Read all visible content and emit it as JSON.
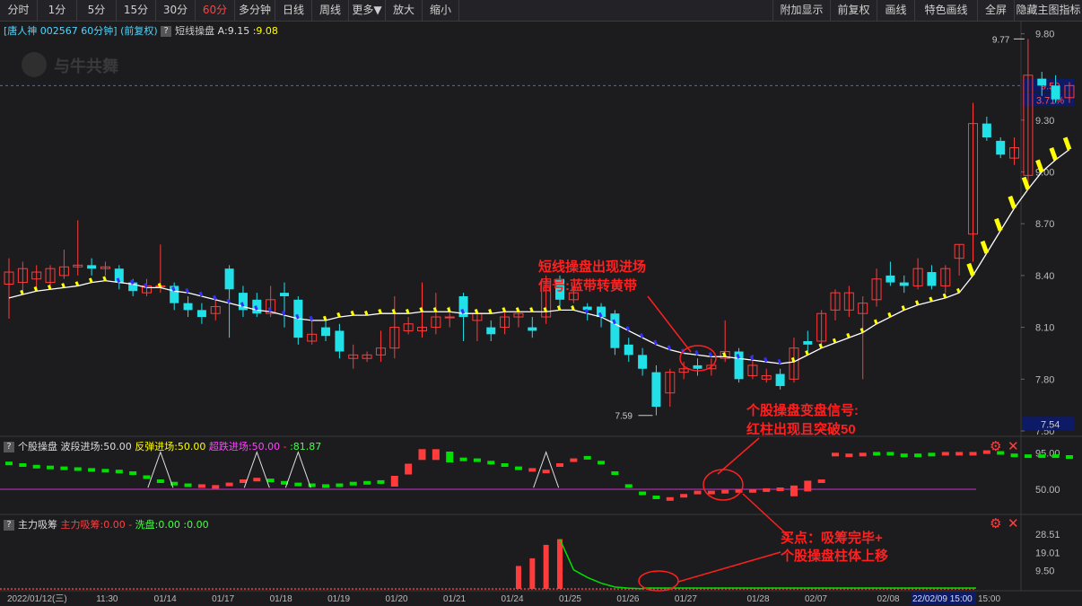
{
  "toolbar": {
    "left": [
      "分时",
      "1分",
      "5分",
      "15分",
      "30分",
      "60分",
      "多分钟",
      "日线",
      "周线",
      "更多▼",
      "放大",
      "缩小"
    ],
    "active": "60分",
    "right": [
      "附加显示",
      "前复权",
      "画线",
      "特色画线",
      "全屏",
      "隐藏主图指标"
    ]
  },
  "main_header": {
    "stock": "[唐人神 002567 60分钟]",
    "mode": "(前复权)",
    "indicator": "短线操盘",
    "a_label": "A:9.15",
    "b_label": ":9.08"
  },
  "watermark": "与牛共舞",
  "price_panel": {
    "yticks": [
      "9.80",
      "9.30",
      "9.00",
      "8.70",
      "8.40",
      "8.10",
      "7.80",
      "7.50"
    ],
    "last_price": "9.50",
    "change_pct": "3.71%",
    "low_box": "7.54",
    "high_label": "9.77",
    "low_label": "7.59"
  },
  "mid_panel": {
    "title": "个股操盘",
    "fields": [
      "波段进场:50.00",
      "反弹进场:50.00",
      "超跌进场:50.00"
    ],
    "extra": ":81.87",
    "yticks": [
      "95.00",
      "50.00"
    ]
  },
  "bottom_panel": {
    "title": "主力吸筹",
    "fields": [
      "主力吸筹:0.00",
      "洗盘:0.00",
      ":0.00"
    ],
    "yticks": [
      "28.51",
      "19.01",
      "9.50"
    ]
  },
  "x_axis": {
    "labels": [
      "2022/01/12(三)",
      "11:30",
      "01/14",
      "01/17",
      "01/18",
      "01/19",
      "01/20",
      "01/21",
      "01/24",
      "01/25",
      "01/26",
      "01/27",
      "01/28",
      "02/07",
      "02/08",
      "02/09"
    ],
    "highlight": "22/02/09 15:00",
    "tail": "15:00"
  },
  "annotations": {
    "a1": [
      "短线操盘出现进场",
      "信号:蓝带转黄带"
    ],
    "a2": [
      "个股操盘变盘信号:",
      "红柱出现且突破50"
    ],
    "a3": [
      "买点：吸筹完毕+",
      "个股操盘柱体上移"
    ]
  },
  "colors": {
    "up": "#ff3b3b",
    "down": "#22e0e8",
    "line": "#ffffff",
    "yellow": "#ffff00",
    "blue": "#3030ff",
    "green": "#00e000",
    "magenta": "#cc33cc",
    "annot": "#ff2020"
  },
  "chart_data": [
    {
      "type": "candlestick",
      "title": "短线操盘",
      "ylim": [
        7.5,
        9.85
      ],
      "candles": [
        [
          8.35,
          8.42,
          8.5,
          8.15
        ],
        [
          8.36,
          8.44,
          8.48,
          8.3
        ],
        [
          8.38,
          8.42,
          8.46,
          8.32
        ],
        [
          8.36,
          8.44,
          8.46,
          8.32
        ],
        [
          8.4,
          8.45,
          8.55,
          8.38
        ],
        [
          8.45,
          8.46,
          8.72,
          8.4
        ],
        [
          8.46,
          8.44,
          8.5,
          8.4
        ],
        [
          8.44,
          8.45,
          8.48,
          8.4
        ],
        [
          8.44,
          8.36,
          8.46,
          8.32
        ],
        [
          8.36,
          8.31,
          8.38,
          8.28
        ],
        [
          8.3,
          8.34,
          8.38,
          8.28
        ],
        [
          8.34,
          8.34,
          8.58,
          8.3
        ],
        [
          8.34,
          8.24,
          8.36,
          8.2
        ],
        [
          8.24,
          8.2,
          8.28,
          8.16
        ],
        [
          8.2,
          8.16,
          8.24,
          8.12
        ],
        [
          8.18,
          8.22,
          8.26,
          8.14
        ],
        [
          8.44,
          8.32,
          8.46,
          8.04
        ],
        [
          8.3,
          8.2,
          8.34,
          8.16
        ],
        [
          8.26,
          8.18,
          8.3,
          8.16
        ],
        [
          8.18,
          8.26,
          8.34,
          8.16
        ],
        [
          8.3,
          8.28,
          8.36,
          8.1
        ],
        [
          8.26,
          8.04,
          8.28,
          8.0
        ],
        [
          8.02,
          8.06,
          8.16,
          8.0
        ],
        [
          8.1,
          8.05,
          8.16,
          8.02
        ],
        [
          8.08,
          7.96,
          8.12,
          7.92
        ],
        [
          7.92,
          7.94,
          8.0,
          7.86
        ],
        [
          7.92,
          7.94,
          7.96,
          7.9
        ],
        [
          7.94,
          7.98,
          8.08,
          7.9
        ],
        [
          7.98,
          8.1,
          8.28,
          7.92
        ],
        [
          8.08,
          8.12,
          8.16,
          8.06
        ],
        [
          8.08,
          8.1,
          8.36,
          8.04
        ],
        [
          8.1,
          8.16,
          8.3,
          8.06
        ],
        [
          8.16,
          8.16,
          8.22,
          8.1
        ],
        [
          8.28,
          8.16,
          8.3,
          8.02
        ],
        [
          8.14,
          8.18,
          8.2,
          8.02
        ],
        [
          8.1,
          8.06,
          8.14,
          8.02
        ],
        [
          8.1,
          8.16,
          8.2,
          8.06
        ],
        [
          8.16,
          8.18,
          8.2,
          8.1
        ],
        [
          8.1,
          8.08,
          8.16,
          8.04
        ],
        [
          8.16,
          8.38,
          8.4,
          8.12
        ],
        [
          8.38,
          8.26,
          8.4,
          8.22
        ],
        [
          8.26,
          8.3,
          8.34,
          8.24
        ],
        [
          8.22,
          8.2,
          8.24,
          8.14
        ],
        [
          8.22,
          8.16,
          8.24,
          8.1
        ],
        [
          8.18,
          7.98,
          8.2,
          7.94
        ],
        [
          8.0,
          7.94,
          8.04,
          7.9
        ],
        [
          7.94,
          7.86,
          7.98,
          7.82
        ],
        [
          7.84,
          7.64,
          7.88,
          7.59
        ],
        [
          7.72,
          7.84,
          7.86,
          7.64
        ],
        [
          7.84,
          7.86,
          7.9,
          7.8
        ],
        [
          7.88,
          7.86,
          7.92,
          7.82
        ],
        [
          7.86,
          7.88,
          7.92,
          7.82
        ],
        [
          7.92,
          7.96,
          8.14,
          7.9
        ],
        [
          7.96,
          7.8,
          7.98,
          7.78
        ],
        [
          7.82,
          7.88,
          7.94,
          7.8
        ],
        [
          7.8,
          7.82,
          7.86,
          7.78
        ],
        [
          7.83,
          7.76,
          7.86,
          7.74
        ],
        [
          7.8,
          7.98,
          8.04,
          7.78
        ],
        [
          8.02,
          8.0,
          8.08,
          7.96
        ],
        [
          8.02,
          8.18,
          8.2,
          7.98
        ],
        [
          8.2,
          8.3,
          8.32,
          8.14
        ],
        [
          8.2,
          8.3,
          8.34,
          8.16
        ],
        [
          8.18,
          8.24,
          8.28,
          7.8
        ],
        [
          8.26,
          8.38,
          8.44,
          8.22
        ],
        [
          8.4,
          8.36,
          8.48,
          8.34
        ],
        [
          8.36,
          8.34,
          8.4,
          8.3
        ],
        [
          8.34,
          8.44,
          8.5,
          8.32
        ],
        [
          8.42,
          8.34,
          8.46,
          8.32
        ],
        [
          8.34,
          8.44,
          8.46,
          8.3
        ],
        [
          8.5,
          8.58,
          8.58,
          8.4
        ],
        [
          8.64,
          9.28,
          9.4,
          8.48
        ],
        [
          9.28,
          9.2,
          9.32,
          9.18
        ],
        [
          9.18,
          9.1,
          9.2,
          9.08
        ],
        [
          9.08,
          9.14,
          9.2,
          9.04
        ],
        [
          8.98,
          9.56,
          9.77,
          8.92
        ],
        [
          9.54,
          9.5,
          9.58,
          9.44
        ],
        [
          9.5,
          9.42,
          9.56,
          9.4
        ],
        [
          9.43,
          9.5,
          9.52,
          9.4
        ]
      ],
      "ma": [
        8.27,
        8.29,
        8.31,
        8.32,
        8.33,
        8.34,
        8.36,
        8.37,
        8.36,
        8.35,
        8.33,
        8.33,
        8.31,
        8.3,
        8.28,
        8.26,
        8.24,
        8.22,
        8.2,
        8.19,
        8.17,
        8.15,
        8.14,
        8.14,
        8.16,
        8.17,
        8.17,
        8.18,
        8.18,
        8.18,
        8.19,
        8.19,
        8.19,
        8.18,
        8.18,
        8.18,
        8.19,
        8.19,
        8.19,
        8.19,
        8.2,
        8.2,
        8.18,
        8.16,
        8.12,
        8.08,
        8.04,
        8.0,
        7.97,
        7.95,
        7.94,
        7.93,
        7.93,
        7.92,
        7.91,
        7.9,
        7.89,
        7.9,
        7.94,
        7.98,
        8.01,
        8.04,
        8.07,
        8.12,
        8.16,
        8.2,
        8.23,
        8.25,
        8.27,
        8.3,
        8.4,
        8.53,
        8.66,
        8.79,
        8.9,
        9.0,
        9.07,
        9.13
      ],
      "ma_color_switch_index": 57
    },
    {
      "type": "bar-segments",
      "title": "个股操盘",
      "ylim": [
        20,
        100
      ],
      "values": [
        82,
        80,
        78,
        77,
        76,
        75,
        74,
        73,
        72,
        70,
        65,
        60,
        57,
        55,
        54,
        53,
        56,
        60,
        62,
        61,
        58,
        56,
        55,
        54,
        55,
        57,
        58,
        59,
        60,
        75,
        93,
        93,
        90,
        87,
        86,
        83,
        80,
        76,
        74,
        72,
        80,
        86,
        89,
        83,
        70,
        54,
        45,
        40,
        38,
        42,
        46,
        46,
        47,
        48,
        48,
        49,
        50,
        48,
        54,
        60,
        93,
        92,
        93,
        94,
        94,
        92,
        92,
        93,
        94,
        94,
        94,
        96,
        95,
        92,
        91,
        91,
        91,
        90
      ],
      "up_flags": [
        false,
        false,
        false,
        false,
        false,
        false,
        false,
        false,
        false,
        false,
        false,
        false,
        false,
        false,
        true,
        true,
        true,
        true,
        true,
        false,
        false,
        false,
        false,
        false,
        false,
        false,
        false,
        false,
        true,
        true,
        true,
        true,
        false,
        false,
        false,
        false,
        false,
        false,
        true,
        true,
        true,
        true,
        false,
        false,
        false,
        false,
        false,
        false,
        true,
        true,
        true,
        true,
        true,
        true,
        true,
        true,
        true,
        true,
        true,
        true,
        true,
        true,
        true,
        false,
        false,
        false,
        false,
        false,
        true,
        true,
        true,
        true,
        false,
        false,
        false,
        false,
        false,
        false
      ],
      "triangles_at": [
        11,
        18,
        21,
        39
      ],
      "threshold": 50
    },
    {
      "type": "bar",
      "title": "主力吸筹",
      "ylim": [
        0,
        30
      ],
      "red_bars": {
        "37": 12,
        "38": 16,
        "39": 23,
        "40": 26
      },
      "green_line": [
        [
          40,
          26
        ],
        [
          41,
          10
        ],
        [
          42,
          6
        ],
        [
          43,
          3
        ],
        [
          44,
          1
        ],
        [
          45,
          0.4
        ],
        [
          46,
          0.1
        ]
      ]
    }
  ]
}
